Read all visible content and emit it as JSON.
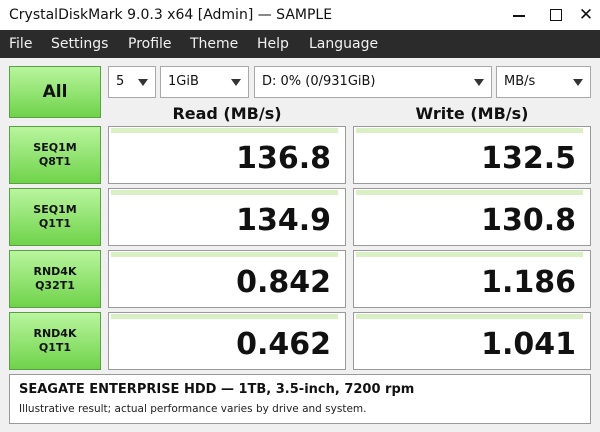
{
  "window": {
    "title": "CrystalDiskMark 9.0.3 x64 [Admin]  —  SAMPLE",
    "minimize_icon": "minimize-icon",
    "maximize_icon": "maximize-icon",
    "close_icon": "close-icon"
  },
  "menu": [
    "File",
    "Settings",
    "Profile",
    "Theme",
    "Help",
    "Language"
  ],
  "controls": {
    "all_label": "All",
    "count": "5",
    "size": "1GiB",
    "drive": "D: 0% (0/931GiB)",
    "unit": "MB/s"
  },
  "headers": {
    "read": "Read (MB/s)",
    "write": "Write (MB/s)"
  },
  "tests": [
    {
      "line1": "SEQ1M",
      "line2": "Q8T1",
      "read": "136.8",
      "write": "132.5",
      "read_fill": 0.98,
      "write_fill": 0.98
    },
    {
      "line1": "SEQ1M",
      "line2": "Q1T1",
      "read": "134.9",
      "write": "130.8",
      "read_fill": 0.98,
      "write_fill": 0.98
    },
    {
      "line1": "RND4K",
      "line2": "Q32T1",
      "read": "0.842",
      "write": "1.186",
      "read_fill": 0.98,
      "write_fill": 0.98
    },
    {
      "line1": "RND4K",
      "line2": "Q1T1",
      "read": "0.462",
      "write": "1.041",
      "read_fill": 0.98,
      "write_fill": 0.98
    }
  ],
  "footer": {
    "drive_info": "SEAGATE ENTERPRISE HDD — 1TB, 3.5-inch, 7200 rpm",
    "note": "Illustrative result; actual performance varies by drive and system."
  },
  "colors": {
    "accent": "#7ddc55",
    "bar_fill": "#d8f0c4",
    "menubar": "#2b2b2b"
  }
}
